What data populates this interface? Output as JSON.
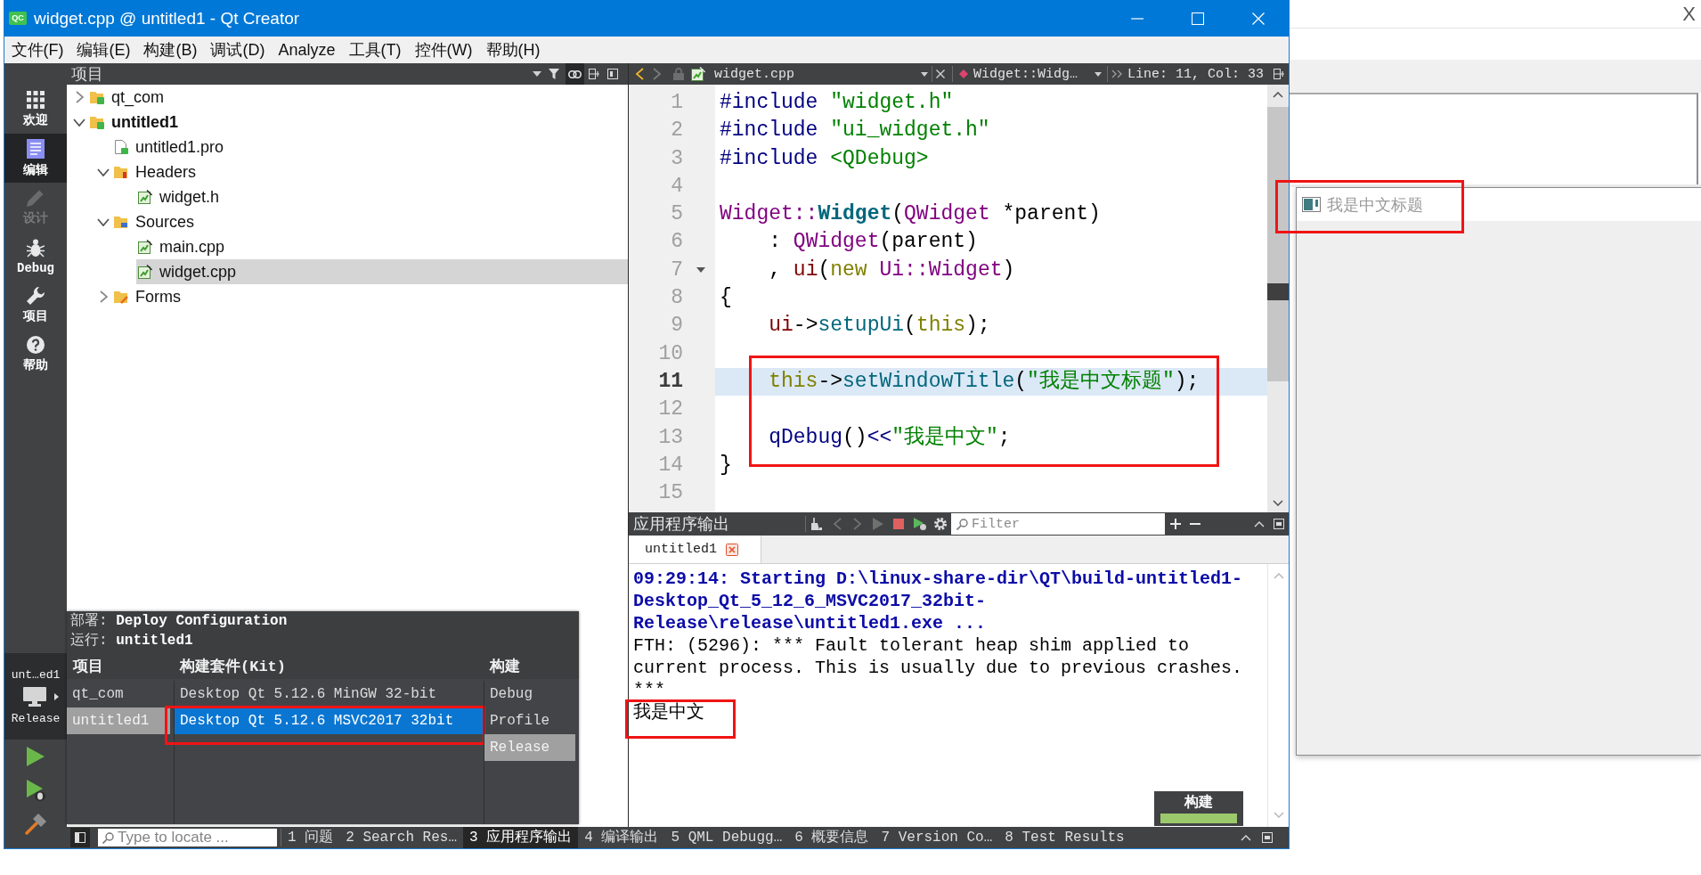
{
  "window": {
    "logo": "QC",
    "title": "widget.cpp @ untitled1 - Qt Creator"
  },
  "menu": [
    "文件(F)",
    "编辑(E)",
    "构建(B)",
    "调试(D)",
    "Analyze",
    "工具(T)",
    "控件(W)",
    "帮助(H)"
  ],
  "modes": [
    {
      "label": "欢迎",
      "kind": "welcome",
      "selected": false,
      "disabled": false
    },
    {
      "label": "编辑",
      "kind": "edit",
      "selected": true,
      "disabled": false
    },
    {
      "label": "设计",
      "kind": "design",
      "selected": false,
      "disabled": true
    },
    {
      "label": "Debug",
      "kind": "debug",
      "selected": false,
      "disabled": false
    },
    {
      "label": "项目",
      "kind": "projects",
      "selected": false,
      "disabled": false
    },
    {
      "label": "帮助",
      "kind": "help",
      "selected": false,
      "disabled": false
    }
  ],
  "target_selector": {
    "project": "unt…ed1",
    "build": "Release"
  },
  "project_panel": {
    "title": "项目",
    "link_button": {
      "on": true
    },
    "tree": [
      {
        "label": "qt_com",
        "kind": "project",
        "expanded": false,
        "selected": false,
        "active": false
      },
      {
        "label": "untitled1",
        "kind": "project",
        "expanded": true,
        "selected": false,
        "active": true,
        "children": [
          {
            "label": "untitled1.pro",
            "kind": "pro",
            "selected": false
          },
          {
            "label": "Headers",
            "kind": "headers",
            "expanded": true,
            "selected": false,
            "children": [
              {
                "label": "widget.h",
                "kind": "file",
                "selected": false
              }
            ]
          },
          {
            "label": "Sources",
            "kind": "sources",
            "expanded": true,
            "selected": false,
            "children": [
              {
                "label": "main.cpp",
                "kind": "file",
                "selected": false
              },
              {
                "label": "widget.cpp",
                "kind": "file",
                "selected": true
              }
            ]
          },
          {
            "label": "Forms",
            "kind": "forms",
            "expanded": false,
            "selected": false
          }
        ]
      }
    ]
  },
  "editor": {
    "toolbar": {
      "file": "widget.cpp",
      "symbol": "Widget::Widg…",
      "position": "Line: 11, Col: 33"
    },
    "lines": [
      {
        "number": "1",
        "tokens": [
          {
            "text": "#include ",
            "kind": "preproc"
          },
          {
            "text": "\"widget.h\"",
            "kind": "string"
          }
        ],
        "current": false,
        "foldable": false,
        "marked": false
      },
      {
        "number": "2",
        "tokens": [
          {
            "text": "#include ",
            "kind": "preproc"
          },
          {
            "text": "\"ui_widget.h\"",
            "kind": "string"
          }
        ],
        "current": false,
        "foldable": false,
        "marked": false
      },
      {
        "number": "3",
        "tokens": [
          {
            "text": "#include ",
            "kind": "preproc"
          },
          {
            "text": "<QDebug>",
            "kind": "string"
          }
        ],
        "current": false,
        "foldable": false,
        "marked": false
      },
      {
        "number": "4",
        "current": false,
        "foldable": false,
        "marked": false
      },
      {
        "number": "5",
        "tokens": [
          {
            "text": "Widget::",
            "kind": "type"
          },
          {
            "text": "Widget",
            "kind": "decl"
          },
          {
            "text": "(",
            "kind": "plain"
          },
          {
            "text": "QWidget",
            "kind": "type"
          },
          {
            "text": " *parent)",
            "kind": "plain"
          }
        ],
        "current": false,
        "foldable": false,
        "marked": false
      },
      {
        "number": "6",
        "tokens": [
          {
            "text": "    : ",
            "kind": "plain"
          },
          {
            "text": "QWidget",
            "kind": "type"
          },
          {
            "text": "(parent)",
            "kind": "plain"
          }
        ],
        "current": false,
        "foldable": false,
        "marked": false
      },
      {
        "number": "7",
        "tokens": [
          {
            "text": "    , ",
            "kind": "plain"
          },
          {
            "text": "ui",
            "kind": "member"
          },
          {
            "text": "(",
            "kind": "plain"
          },
          {
            "text": "new ",
            "kind": "keyword"
          },
          {
            "text": "Ui::Widget",
            "kind": "type"
          },
          {
            "text": ")",
            "kind": "plain"
          }
        ],
        "current": false,
        "foldable": true,
        "marked": false
      },
      {
        "number": "8",
        "tokens": [
          {
            "text": "{",
            "kind": "plain"
          }
        ],
        "current": false,
        "foldable": false,
        "marked": false
      },
      {
        "number": "9",
        "tokens": [
          {
            "text": "    ui",
            "kind": "member"
          },
          {
            "text": "->",
            "kind": "plain"
          },
          {
            "text": "setupUi",
            "kind": "func"
          },
          {
            "text": "(",
            "kind": "plain"
          },
          {
            "text": "this",
            "kind": "keyword"
          },
          {
            "text": ");",
            "kind": "plain"
          }
        ],
        "current": false,
        "foldable": false,
        "marked": false
      },
      {
        "number": "10",
        "current": false,
        "foldable": false,
        "marked": false
      },
      {
        "number": "11",
        "tokens": [
          {
            "text": "    this",
            "kind": "keyword"
          },
          {
            "text": "->",
            "kind": "plain"
          },
          {
            "text": "setWindowTitle",
            "kind": "func"
          },
          {
            "text": "(",
            "kind": "plain"
          },
          {
            "text": "\"我是中文标题\"",
            "kind": "string"
          },
          {
            "text": ");",
            "kind": "plain"
          }
        ],
        "current": true,
        "foldable": false,
        "marked": true
      },
      {
        "number": "12",
        "current": false,
        "foldable": false,
        "marked": true
      },
      {
        "number": "13",
        "tokens": [
          {
            "text": "    qDebug",
            "kind": "macro"
          },
          {
            "text": "()",
            "kind": "plain"
          },
          {
            "text": "<<",
            "kind": "macro"
          },
          {
            "text": "\"我是中文\"",
            "kind": "string"
          },
          {
            "text": ";",
            "kind": "plain"
          }
        ],
        "current": false,
        "foldable": false,
        "marked": true
      },
      {
        "number": "14",
        "tokens": [
          {
            "text": "}",
            "kind": "plain"
          }
        ],
        "current": false,
        "foldable": false,
        "marked": false
      },
      {
        "number": "15",
        "current": false,
        "foldable": false,
        "marked": false
      }
    ]
  },
  "output_pane": {
    "title": "应用程序输出",
    "filter": {
      "placeholder": "Filter"
    },
    "tabs": [
      {
        "label": "untitled1",
        "selected": true
      }
    ],
    "lines": [
      {
        "text": "09:29:14: Starting D:\\linux-share-dir\\QT\\build-untitled1-Desktop_Qt_5_12_6_MSVC2017_32bit-Release\\release\\untitled1.exe ...",
        "kind": "status",
        "marked": false
      },
      {
        "text": "FTH: (5296): *** Fault tolerant heap shim applied to current process. This is usually due to previous crashes. ***",
        "kind": "stdout",
        "marked": false
      },
      {
        "text": "我是中文",
        "kind": "stdout",
        "marked": true
      }
    ]
  },
  "build_progress": {
    "label": "构建",
    "level": 1
  },
  "kit_popup": {
    "deploy": "部署: **Deploy Configuration**",
    "run": "运行: **untitled1**",
    "columns": [
      "项目",
      "构建套件(Kit)",
      "构建"
    ],
    "projects": [
      {
        "label": "qt_com",
        "selected": false
      },
      {
        "label": "untitled1",
        "selected": true
      }
    ],
    "kits": [
      {
        "label": "Desktop Qt 5.12.6 MinGW 32-bit",
        "selected": false,
        "marked": false
      },
      {
        "label": "Desktop Qt 5.12.6 MSVC2017 32bit",
        "selected": true,
        "marked": true
      }
    ],
    "builds": [
      {
        "label": "Debug",
        "selected": false
      },
      {
        "label": "Profile",
        "selected": false
      },
      {
        "label": "Release",
        "selected": true
      }
    ]
  },
  "status_bar": {
    "locator": {
      "placeholder": "Type to locate ..."
    },
    "panes": [
      {
        "label": "1 问题",
        "selected": false
      },
      {
        "label": "2 Search Res…",
        "selected": false
      },
      {
        "label": "3 应用程序输出",
        "selected": true
      },
      {
        "label": "4 编译输出",
        "selected": false
      },
      {
        "label": "5 QML Debugg…",
        "selected": false
      },
      {
        "label": "6 概要信息",
        "selected": false
      },
      {
        "label": "7 Version Co…",
        "selected": false
      },
      {
        "label": "8 Test Results",
        "selected": false
      }
    ]
  },
  "background_window": {
    "close_button": "X"
  },
  "app_window": {
    "title": "我是中文标题",
    "marked": true
  }
}
